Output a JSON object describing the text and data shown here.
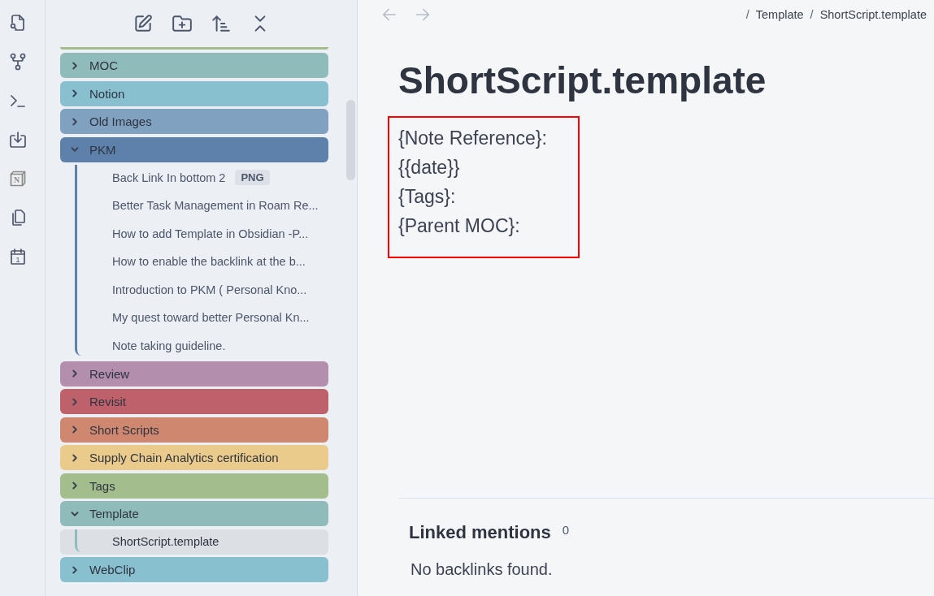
{
  "ribbon": [
    {
      "kind": "search"
    },
    {
      "kind": "graph"
    },
    {
      "kind": "terminal"
    },
    {
      "kind": "import"
    },
    {
      "kind": "cube",
      "glyph": "N"
    },
    {
      "kind": "pages"
    },
    {
      "kind": "calendar",
      "glyph": "1"
    }
  ],
  "sidebar": {
    "toolbar": [
      {
        "kind": "note"
      },
      {
        "kind": "folder"
      },
      {
        "kind": "sort"
      },
      {
        "kind": "collapse"
      }
    ],
    "tree": [
      {
        "color": "#a3be8c"
      },
      {
        "name": "MOC",
        "color": "#8fbcbb",
        "expanded": false
      },
      {
        "name": "Notion",
        "color": "#88c0d0",
        "expanded": false
      },
      {
        "name": "Old Images",
        "color": "#81a1c1",
        "expanded": false
      },
      {
        "name": "PKM",
        "color": "#5e81ac",
        "expanded": true,
        "children": [
          {
            "name": "Back Link In bottom 2",
            "badge": "PNG",
            "selected": false
          },
          {
            "name": "Better Task Management in Roam Re...",
            "selected": false
          },
          {
            "name": "How to add Template in Obsidian -P...",
            "selected": false
          },
          {
            "name": "How to enable the backlink at the b...",
            "selected": false
          },
          {
            "name": "Introduction to PKM ( Personal Kno...",
            "selected": false
          },
          {
            "name": "My quest toward better Personal Kn...",
            "selected": false
          },
          {
            "name": "Note taking guideline.",
            "selected": false
          }
        ]
      },
      {
        "name": "Review",
        "color": "#b48ead",
        "expanded": false
      },
      {
        "name": "Revisit",
        "color": "#bf616a",
        "expanded": false
      },
      {
        "name": "Short Scripts",
        "color": "#d08770",
        "expanded": false
      },
      {
        "name": "Supply Chain Analytics certification",
        "color": "#ebcb8b",
        "expanded": false
      },
      {
        "name": "Tags",
        "color": "#a3be8c",
        "expanded": false
      },
      {
        "name": "Template",
        "color": "#8fbcbb",
        "expanded": true,
        "children": [
          {
            "name": "ShortScript.template",
            "selected": true
          }
        ]
      },
      {
        "name": "WebClip",
        "color": "#88c0d0",
        "expanded": false
      }
    ]
  },
  "nav": [
    {
      "kind": "back",
      "disabled": true
    },
    {
      "kind": "forward",
      "disabled": true
    }
  ],
  "breadcrumb": [
    {
      "separator": "/",
      "label": "Template"
    },
    {
      "separator": "/",
      "label": "ShortScript.template"
    }
  ],
  "note": {
    "title": "ShortScript.template",
    "highlighted": true,
    "lines": [
      "{Note Reference}:",
      "{{date}}",
      "{Tags}:",
      "{Parent MOC}:"
    ]
  },
  "backlinks": {
    "title": "Linked mentions",
    "count": "0",
    "empty_text": "No backlinks found."
  }
}
